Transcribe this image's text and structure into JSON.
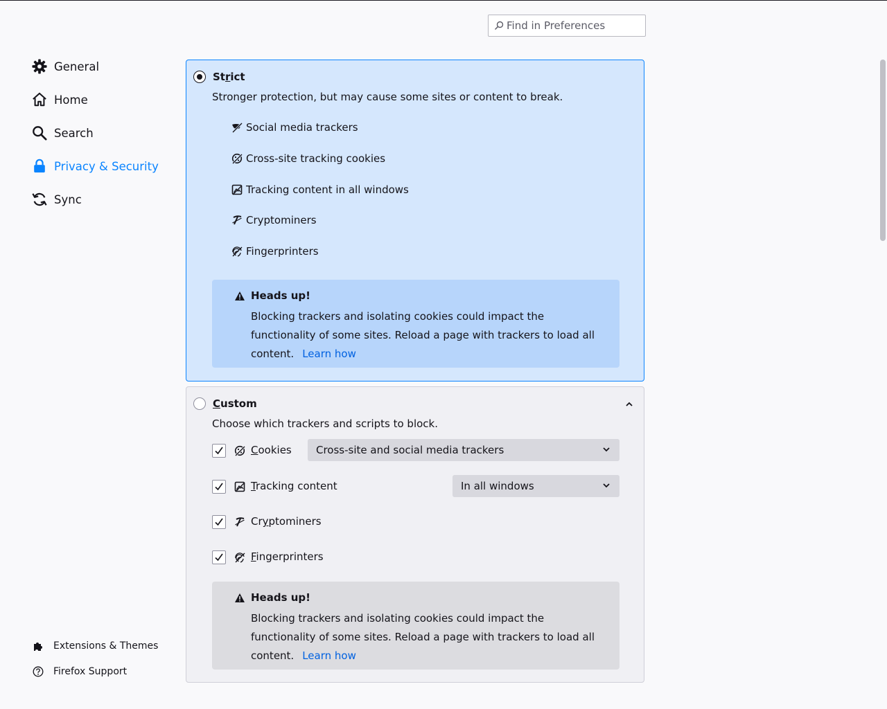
{
  "search": {
    "placeholder": "Find in Preferences",
    "value": ""
  },
  "sidebar": {
    "items": [
      {
        "label": "General",
        "icon": "gear-icon",
        "active": false
      },
      {
        "label": "Home",
        "icon": "home-icon",
        "active": false
      },
      {
        "label": "Search",
        "icon": "search-icon",
        "active": false
      },
      {
        "label": "Privacy & Security",
        "icon": "lock-icon",
        "active": true
      },
      {
        "label": "Sync",
        "icon": "sync-icon",
        "active": false
      }
    ],
    "footer": [
      {
        "label": "Extensions & Themes",
        "icon": "puzzle-icon"
      },
      {
        "label": "Firefox Support",
        "icon": "help-icon"
      }
    ]
  },
  "strict": {
    "title_pre": "St",
    "title_key": "r",
    "title_post": "ict",
    "selected": true,
    "description": "Stronger protection, but may cause some sites or content to break.",
    "features": [
      {
        "label": "Social media trackers",
        "icon": "social-tracker-icon"
      },
      {
        "label": "Cross-site tracking cookies",
        "icon": "cookie-icon"
      },
      {
        "label": "Tracking content in all windows",
        "icon": "tracking-content-icon"
      },
      {
        "label": "Cryptominers",
        "icon": "cryptominer-icon"
      },
      {
        "label": "Fingerprinters",
        "icon": "fingerprint-icon"
      }
    ],
    "warning": {
      "title": "Heads up!",
      "body": "Blocking trackers and isolating cookies could impact the functionality of some sites. Reload a page with trackers to load all content.",
      "link": "Learn how"
    }
  },
  "custom": {
    "title_key": "C",
    "title_post": "ustom",
    "selected": false,
    "expanded": true,
    "description": "Choose which trackers and scripts to block.",
    "rows": [
      {
        "key": "C",
        "rest": "ookies",
        "checked": true,
        "icon": "cookie-icon",
        "dropdown": "Cross-site and social media trackers"
      },
      {
        "key": "T",
        "rest": "racking content",
        "checked": true,
        "icon": "tracking-content-icon",
        "dropdown": "In all windows"
      },
      {
        "pre": "Cr",
        "key": "y",
        "rest": "ptominers",
        "checked": true,
        "icon": "cryptominer-icon"
      },
      {
        "key": "F",
        "rest": "ingerprinters",
        "checked": true,
        "icon": "fingerprint-icon"
      }
    ],
    "warning": {
      "title": "Heads up!",
      "body": "Blocking trackers and isolating cookies could impact the functionality of some sites. Reload a page with trackers to load all content.",
      "link": "Learn how"
    }
  },
  "colors": {
    "accent": "#0a84ff",
    "strict_bg": "#d5e7fd",
    "strict_warning_bg": "#b7d5fb",
    "custom_bg": "#f0f0f4",
    "link": "#0061e0"
  }
}
